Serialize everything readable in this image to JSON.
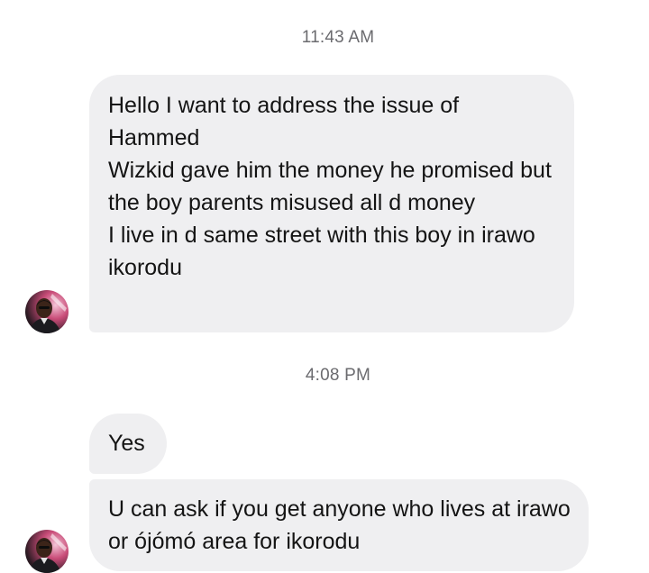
{
  "conversation": {
    "groups": [
      {
        "time": "11:43 AM",
        "messages": [
          {
            "lines": [
              "Hello I want to address the issue of Hammed",
              "Wizkid gave him the money he promised but the boy parents misused all d money",
              "I live in d same street with this boy in irawo ikorodu"
            ]
          }
        ]
      },
      {
        "time": "4:08 PM",
        "messages": [
          {
            "lines": [
              "Yes"
            ]
          },
          {
            "lines": [
              "U can ask if you get anyone who lives at irawo or ójómó area for ikorodu"
            ]
          }
        ]
      }
    ]
  },
  "colors": {
    "bubble_background": "#efeff1",
    "timestamp_text": "#6b6b6f",
    "page_background": "#ffffff"
  },
  "icons": {
    "sender_avatar": "profile-photo"
  }
}
